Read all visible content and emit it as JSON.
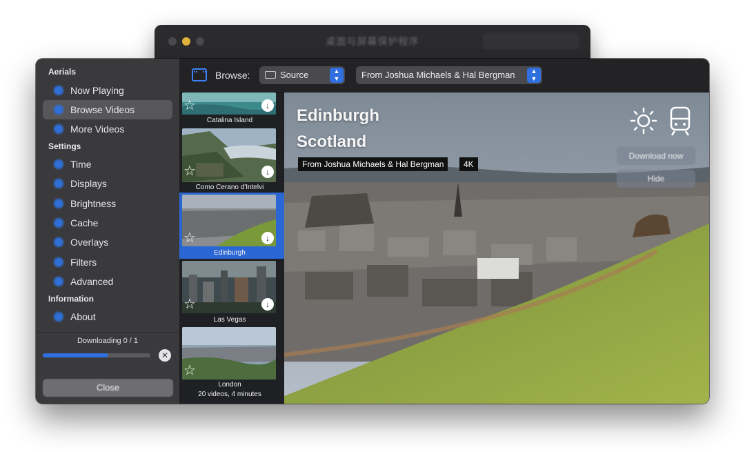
{
  "background_window": {
    "title": "桌面与屏幕保护程序"
  },
  "sidebar": {
    "sections": [
      {
        "label": "Aerials"
      },
      {
        "label": "Settings"
      },
      {
        "label": "Information"
      }
    ],
    "items": [
      {
        "label": "Now Playing",
        "icon": "play-icon"
      },
      {
        "label": "Browse Videos",
        "icon": "film-icon",
        "active": true
      },
      {
        "label": "More Videos",
        "icon": "download-icon"
      },
      {
        "label": "Time",
        "icon": "clock-icon"
      },
      {
        "label": "Displays",
        "icon": "display-icon"
      },
      {
        "label": "Brightness",
        "icon": "brightness-icon"
      },
      {
        "label": "Cache",
        "icon": "cache-icon"
      },
      {
        "label": "Overlays",
        "icon": "overlays-icon"
      },
      {
        "label": "Filters",
        "icon": "filter-icon"
      },
      {
        "label": "Advanced",
        "icon": "gear-icon"
      },
      {
        "label": "About",
        "icon": "info-icon"
      }
    ],
    "download": {
      "label": "Downloading 0 / 1",
      "progress": 0.6
    },
    "close_label": "Close"
  },
  "toolbar": {
    "browse_label": "Browse:",
    "source_value": "Source",
    "author_value": "From Joshua Michaels & Hal Bergman"
  },
  "videos": [
    {
      "name": "Catalina Island"
    },
    {
      "name": "Como Cerano d'Intelvi"
    },
    {
      "name": "Edinburgh",
      "selected": true
    },
    {
      "name": "Las Vegas"
    },
    {
      "name": "London",
      "count": "20 videos, 4 minutes"
    }
  ],
  "preview": {
    "title": "Edinburgh",
    "subtitle": "Scotland",
    "credit": "From Joshua Michaels & Hal Bergman",
    "quality": "4K",
    "download_label": "Download now",
    "hide_label": "Hide",
    "time_of_day_icon": "sun-icon",
    "scene_icon": "train-icon"
  },
  "colors": {
    "accent": "#2f6fe0",
    "selection": "#2a66d4",
    "sidebar": "#3a3a3c"
  }
}
